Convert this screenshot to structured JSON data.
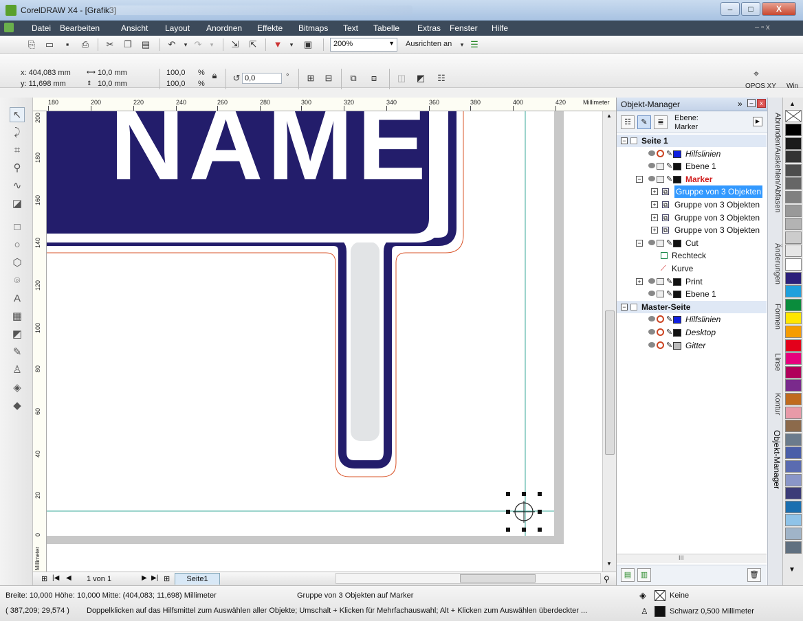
{
  "window": {
    "title": "CorelDRAW X4 - [Grafik3]",
    "minimize": "–",
    "maximize": "□",
    "close": "X"
  },
  "menu": {
    "items": [
      "Datei",
      "Bearbeiten",
      "Ansicht",
      "Layout",
      "Anordnen",
      "Effekte",
      "Bitmaps",
      "Text",
      "Tabelle",
      "Extras",
      "Fenster",
      "Hilfe"
    ],
    "doc_controls": "–  ▫  x"
  },
  "toolbar_standard": {
    "zoom": "200%",
    "snap_label": "Ausrichten an"
  },
  "property_bar": {
    "x": "x: 404,083 mm",
    "y": "y: 11,698 mm",
    "width": "10,0 mm",
    "height": "10,0 mm",
    "scale_x": "100,0",
    "scale_y": "100,0",
    "pct1": "%",
    "pct2": "%",
    "rotation": "0,0",
    "degree": "°",
    "opos_label": "OPOS XY",
    "win_label": "Win"
  },
  "ruler": {
    "h_ticks": [
      "180",
      "200",
      "220",
      "240",
      "260",
      "280",
      "300",
      "320",
      "340",
      "360",
      "380",
      "400",
      "420"
    ],
    "unit": "Millimeter",
    "v_ticks": [
      "200",
      "180",
      "160",
      "140",
      "120",
      "100",
      "80",
      "60",
      "40",
      "20",
      "0"
    ],
    "v_unit": "Millimeter"
  },
  "canvas": {
    "sign_text": "NAME",
    "colors": {
      "navy": "#231d6b",
      "cut_line": "#d9542a",
      "guide": "#3aa99a",
      "light_gray": "#e2e4e6"
    }
  },
  "page_nav": {
    "page_count": "1 von 1",
    "page_tab": "Seite1"
  },
  "object_manager": {
    "title": "Objekt-Manager",
    "layer_label": "Ebene:",
    "layer_value": "Marker",
    "rows": [
      {
        "text": "Seite 1",
        "kind": "page"
      },
      {
        "text": "Hilfslinien",
        "kind": "layer",
        "italic": true,
        "color": "#1020e0"
      },
      {
        "text": "Ebene 1",
        "kind": "layer",
        "color": "#111111"
      },
      {
        "text": "Marker",
        "kind": "layer-active",
        "color": "#111111"
      },
      {
        "text": "Gruppe von 3 Objekten",
        "kind": "group-sel"
      },
      {
        "text": "Gruppe von 3 Objekten",
        "kind": "group"
      },
      {
        "text": "Gruppe von 3 Objekten",
        "kind": "group"
      },
      {
        "text": "Gruppe von 3 Objekten",
        "kind": "group"
      },
      {
        "text": "Cut",
        "kind": "layer",
        "color": "#111111"
      },
      {
        "text": "Rechteck",
        "kind": "object"
      },
      {
        "text": "Kurve",
        "kind": "object"
      },
      {
        "text": "Print",
        "kind": "layer",
        "color": "#111111"
      },
      {
        "text": "Ebene 1",
        "kind": "layer",
        "color": "#111111"
      },
      {
        "text": "Master-Seite",
        "kind": "page"
      },
      {
        "text": "Hilfslinien",
        "kind": "layer",
        "italic": true,
        "color": "#1020e0"
      },
      {
        "text": "Desktop",
        "kind": "layer",
        "italic": true,
        "color": "#111111"
      },
      {
        "text": "Gitter",
        "kind": "layer",
        "italic": true,
        "color": "#bbbbbb"
      }
    ]
  },
  "dock_tabs": [
    "Abrunden/Auskehlen/Abfasen",
    "Änderungen",
    "Formen",
    "Linse",
    "Kontur",
    "Objekt-Manager"
  ],
  "palette": [
    "#000000",
    "#1a1a1a",
    "#333333",
    "#4d4d4d",
    "#666666",
    "#808080",
    "#999999",
    "#b3b3b3",
    "#cccccc",
    "#e6e6e6",
    "#ffffff",
    "#2b1f7a",
    "#1fa0dc",
    "#0a8c3c",
    "#ffe600",
    "#f59c00",
    "#e3001b",
    "#e5007d",
    "#b0005a",
    "#7a2a8c",
    "#c06b1e",
    "#e89aa8",
    "#8c6a4b",
    "#6b7b8c",
    "#4a5ea8",
    "#5a6bb0",
    "#8a96c8",
    "#3c3c78",
    "#1a6fb0",
    "#8fc3e8",
    "#a0b4c8",
    "#607080"
  ],
  "status": {
    "size_info": "Breite: 10,000  Höhe: 10,000  Mitte: (404,083; 11,698)  Millimeter",
    "selection_info": "Gruppe von 3 Objekten auf Marker",
    "coords": "( 387,209; 29,574 )",
    "hint": "Doppelklicken auf das Hilfsmittel zum Auswählen aller Objekte; Umschalt + Klicken für Mehrfachauswahl; Alt + Klicken zum Auswählen überdeckter ...",
    "fill": "Keine",
    "outline": "Schwarz  0,500 Millimeter"
  }
}
